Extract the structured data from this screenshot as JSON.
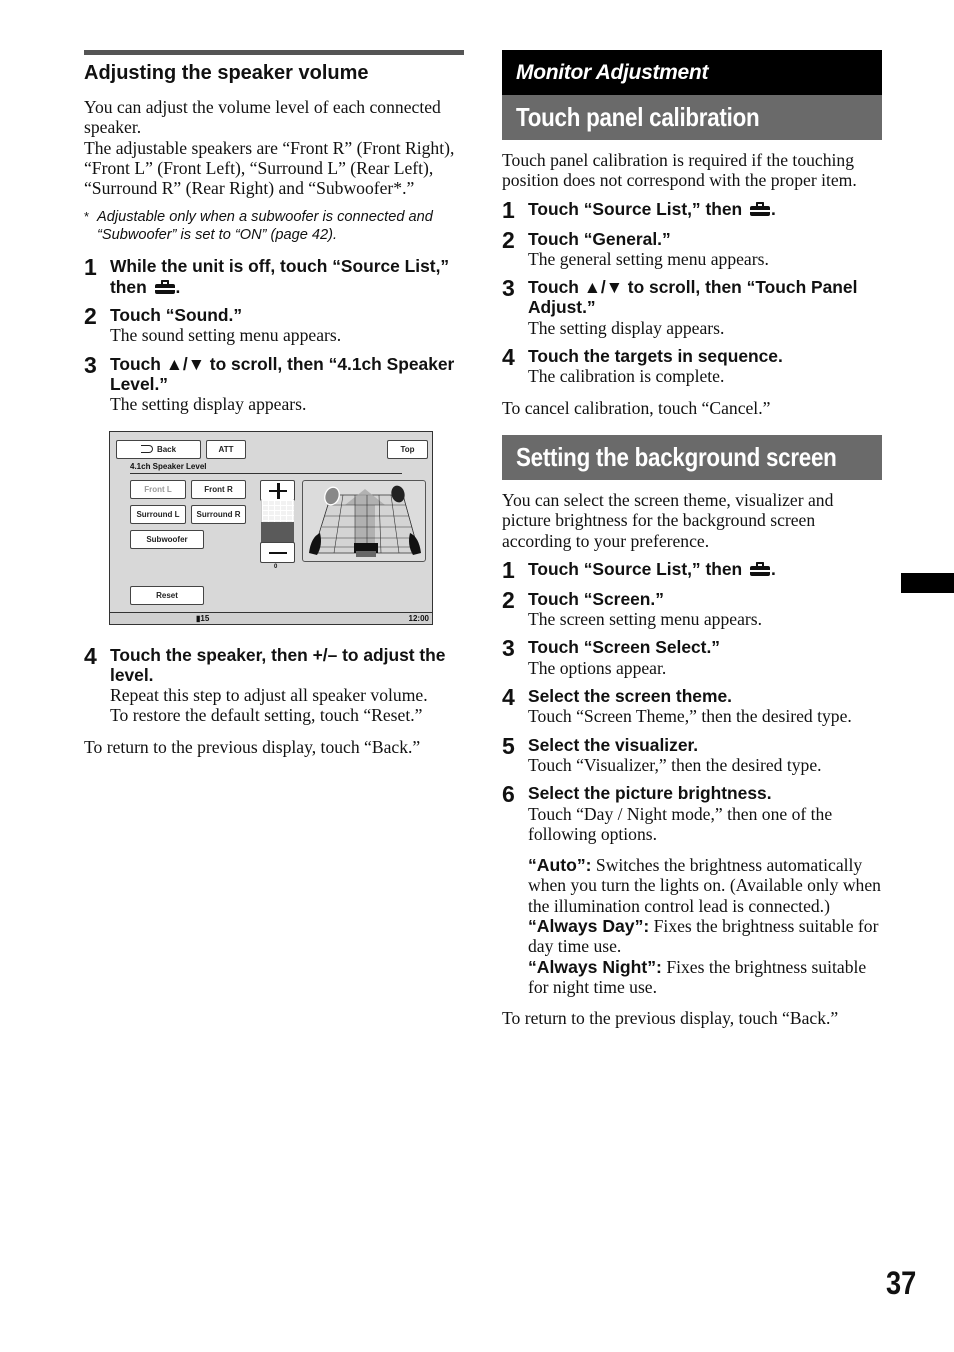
{
  "left": {
    "title": "Adjusting the speaker volume",
    "intro_1": "You can adjust the volume level of each connected speaker.",
    "intro_2": "The adjustable speakers are “Front R” (Front Right), “Front L” (Front Left), “Surround L” (Rear Left), “Surround R” (Rear Right) and “Subwoofer*.”",
    "note_marker": "*",
    "note": "Adjustable only when a subwoofer is connected and “Subwoofer” is set to “ON” (page 42).",
    "steps": [
      {
        "num": "1",
        "head_before": "While the unit is off, touch “Source List,” then ",
        "head_after": ".",
        "icon": "toolbox-icon",
        "desc": ""
      },
      {
        "num": "2",
        "head": "Touch “Sound.”",
        "desc": "The sound setting menu appears."
      },
      {
        "num": "3",
        "head": "Touch ▲/▼ to scroll, then “4.1ch Speaker Level.”",
        "desc": "The setting display appears."
      },
      {
        "num": "4",
        "head": "Touch the speaker, then +/– to adjust the level.",
        "desc_1": "Repeat this step to adjust all speaker volume.",
        "desc_2": "To restore the default setting, touch “Reset.”"
      }
    ],
    "outro": "To return to the previous display, touch “Back.”"
  },
  "device_screen": {
    "back_label": "Back",
    "att_label": "ATT",
    "top_label": "Top",
    "screen_title": "4.1ch Speaker Level",
    "speakers": [
      "Front L",
      "Front R",
      "Surround L",
      "Surround R",
      "Subwoofer"
    ],
    "selected_speaker": "Front L",
    "level_value": "0",
    "reset_label": "Reset",
    "volume": "15",
    "clock": "12:00"
  },
  "right": {
    "chapter": "Monitor Adjustment",
    "section1": {
      "title": "Touch panel calibration",
      "intro": "Touch panel calibration is required if the touching position does not correspond with the proper item.",
      "steps": [
        {
          "num": "1",
          "head_before": "Touch “Source List,” then ",
          "head_after": ".",
          "icon": "toolbox-icon"
        },
        {
          "num": "2",
          "head": "Touch “General.”",
          "desc": "The general setting menu appears."
        },
        {
          "num": "3",
          "head": "Touch ▲/▼ to scroll, then “Touch Panel Adjust.”",
          "desc": "The setting display appears."
        },
        {
          "num": "4",
          "head": "Touch the targets in sequence.",
          "desc": "The calibration is complete."
        }
      ],
      "outro": "To cancel calibration, touch “Cancel.”"
    },
    "section2": {
      "title": "Setting the background screen",
      "intro": "You can select the screen theme, visualizer and picture brightness for the background screen according to your preference.",
      "steps": [
        {
          "num": "1",
          "head_before": "Touch “Source List,” then ",
          "head_after": ".",
          "icon": "toolbox-icon"
        },
        {
          "num": "2",
          "head": "Touch “Screen.”",
          "desc": "The screen setting menu appears."
        },
        {
          "num": "3",
          "head": "Touch “Screen Select.”",
          "desc": "The options appear."
        },
        {
          "num": "4",
          "head": "Select the screen theme.",
          "desc": "Touch “Screen Theme,” then the desired type."
        },
        {
          "num": "5",
          "head": "Select the visualizer.",
          "desc": "Touch “Visualizer,” then the desired type."
        },
        {
          "num": "6",
          "head": "Select the picture brightness.",
          "desc": "Touch “Day / Night mode,” then one of the following options."
        }
      ],
      "options": [
        {
          "label": "“Auto”:",
          "text": " Switches the brightness automatically when you turn the lights on. (Available only when the illumination control lead is connected.)"
        },
        {
          "label": "“Always Day”:",
          "text": " Fixes the brightness suitable for day time use."
        },
        {
          "label": "“Always Night”:",
          "text": " Fixes the brightness suitable for night time use."
        }
      ],
      "outro": "To return to the previous display, touch “Back.”"
    }
  },
  "page_number": "37"
}
